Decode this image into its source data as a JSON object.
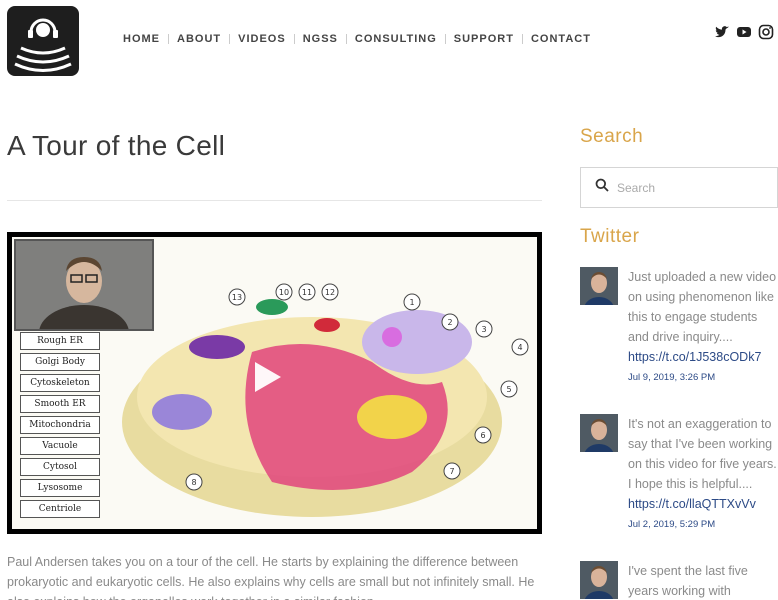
{
  "header": {
    "logo_name": "headphones-logo",
    "nav": [
      {
        "label": "HOME"
      },
      {
        "label": "ABOUT"
      },
      {
        "label": "VIDEOS"
      },
      {
        "label": "NGSS"
      },
      {
        "label": "CONSULTING"
      },
      {
        "label": "SUPPORT"
      },
      {
        "label": "CONTACT"
      }
    ],
    "social": [
      "twitter-icon",
      "youtube-icon",
      "instagram-icon"
    ]
  },
  "main": {
    "title": "A Tour of the Cell",
    "video": {
      "organelles": [
        "Rough ER",
        "Golgi Body",
        "Cytoskeleton",
        "Smooth ER",
        "Mitochondria",
        "Vacuole",
        "Cytosol",
        "Lysosome",
        "Centriole"
      ],
      "diagram_labels": [
        "1",
        "2",
        "3",
        "4",
        "5",
        "6",
        "7",
        "8",
        "10",
        "11",
        "12",
        "13"
      ]
    },
    "description": "Paul Andersen takes you on a tour of the cell. He starts by explaining the difference between prokaryotic and eukaryotic cells. He also explains why cells are small but not infinitely small. He also explains how the organelles work together in a similar fashion."
  },
  "sidebar": {
    "search_heading": "Search",
    "search_placeholder": "Search",
    "twitter_heading": "Twitter",
    "tweets": [
      {
        "text": "Just uploaded a new video on using phenomenon like this to engage students and drive inquiry....",
        "link": "https://t.co/1J538cODk7",
        "time": "Jul 9, 2019, 3:26 PM"
      },
      {
        "text": "It's not an exaggeration to say that I've been working on this video for five years. I hope this is helpful....",
        "link": "https://t.co/llaQTTXvVv",
        "time": "Jul 2, 2019, 5:29 PM"
      },
      {
        "text": "I've spent the last five years working with",
        "link": "",
        "time": ""
      }
    ]
  }
}
